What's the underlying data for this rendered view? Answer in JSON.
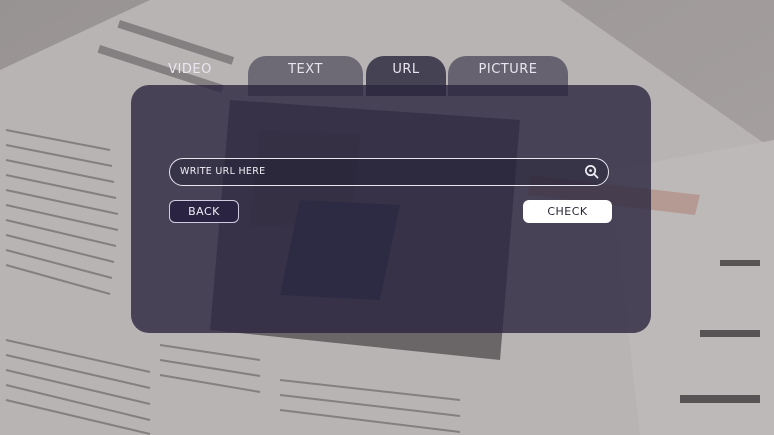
{
  "tabs": {
    "video": "VIDEO",
    "text": "TEXT",
    "url": "URL",
    "picture": "PICTURE",
    "active": "url"
  },
  "url_form": {
    "placeholder": "WRITE URL HERE",
    "value": "",
    "search_icon": "search-icon"
  },
  "buttons": {
    "back": "BACK",
    "check": "CHECK"
  },
  "colors": {
    "panel": "#2a263e",
    "active_tab": "#2c2840",
    "check_button": "#ffffff",
    "back_button": "#2a2442"
  }
}
